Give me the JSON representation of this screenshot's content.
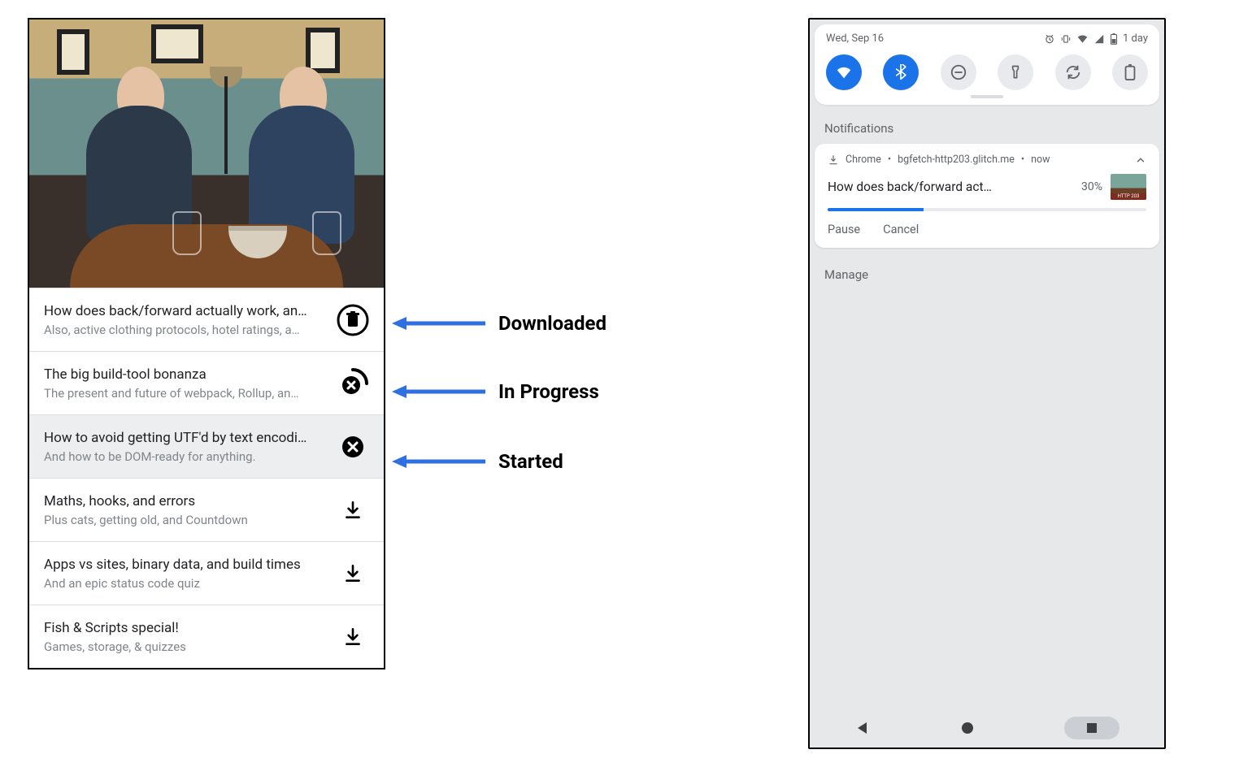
{
  "left": {
    "episodes": [
      {
        "title": "How does back/forward actually work, an…",
        "subtitle": "Also, active clothing protocols, hotel ratings, a…",
        "state": "downloaded",
        "selected": false
      },
      {
        "title": "The big build-tool bonanza",
        "subtitle": "The present and future of webpack, Rollup, an…",
        "state": "in_progress",
        "selected": false
      },
      {
        "title": "How to avoid getting UTF'd by text encodi…",
        "subtitle": "And how to be DOM-ready for anything.",
        "state": "started",
        "selected": true
      },
      {
        "title": "Maths, hooks, and errors",
        "subtitle": "Plus cats, getting old, and Countdown",
        "state": "idle",
        "selected": false
      },
      {
        "title": "Apps vs sites, binary data, and build times",
        "subtitle": "And an epic status code quiz",
        "state": "idle",
        "selected": false
      },
      {
        "title": "Fish & Scripts special!",
        "subtitle": "Games, storage, & quizzes",
        "state": "idle",
        "selected": false
      }
    ]
  },
  "annotations": {
    "downloaded": "Downloaded",
    "in_progress": "In Progress",
    "started": "Started"
  },
  "right": {
    "status": {
      "date": "Wed, Sep 16",
      "battery_text": "1 day"
    },
    "section_label": "Notifications",
    "notif": {
      "app": "Chrome",
      "source": "bgfetch-http203.glitch.me",
      "when": "now",
      "title": "How does back/forward act…",
      "percent_text": "30%",
      "percent_value": 30,
      "actions": {
        "pause": "Pause",
        "cancel": "Cancel"
      }
    },
    "manage": "Manage"
  }
}
